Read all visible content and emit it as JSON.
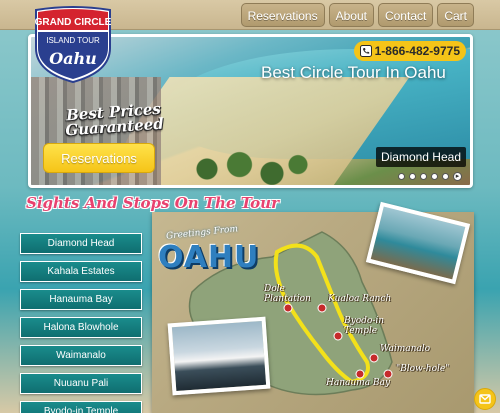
{
  "nav": {
    "items": [
      "Reservations",
      "About",
      "Contact",
      "Cart"
    ]
  },
  "logo": {
    "line1": "GRAND CIRCLE",
    "line2": "ISLAND TOUR",
    "line3": "Oahu"
  },
  "hero": {
    "phone": "1-866-482-9775",
    "title": "Best Circle Tour In Oahu",
    "promo": "Best Prices Guaranteed",
    "reserve_label": "Reservations",
    "caption": "Diamond Head",
    "slide_count": 5
  },
  "section": {
    "title": "Sights And Stops On The Tour"
  },
  "stops": [
    "Diamond Head",
    "Kahala Estates",
    "Hanauma Bay",
    "Halona Blowhole",
    "Waimanalo",
    "Nuuanu Pali",
    "Byodo-in Temple"
  ],
  "map": {
    "greeting": "Greetings From",
    "island": "OAHU",
    "labels": {
      "dole": "Dole Plantation",
      "kualoa": "Kualoa Ranch",
      "byodo": "Byodo-in Temple",
      "waimanalo": "Waimanalo",
      "blowhole": "\"Blow-hole\"",
      "hanauma": "Hanauma Bay"
    }
  },
  "colors": {
    "nav_bg": "#c8b38a",
    "accent_yellow": "#f5c418",
    "teal_button": "#1a8c8c",
    "section_pink": "#e8426f",
    "logo_red": "#d4232f",
    "logo_blue": "#2a3f8f"
  },
  "icons": {
    "phone": "phone-icon",
    "chat": "chat-icon"
  }
}
